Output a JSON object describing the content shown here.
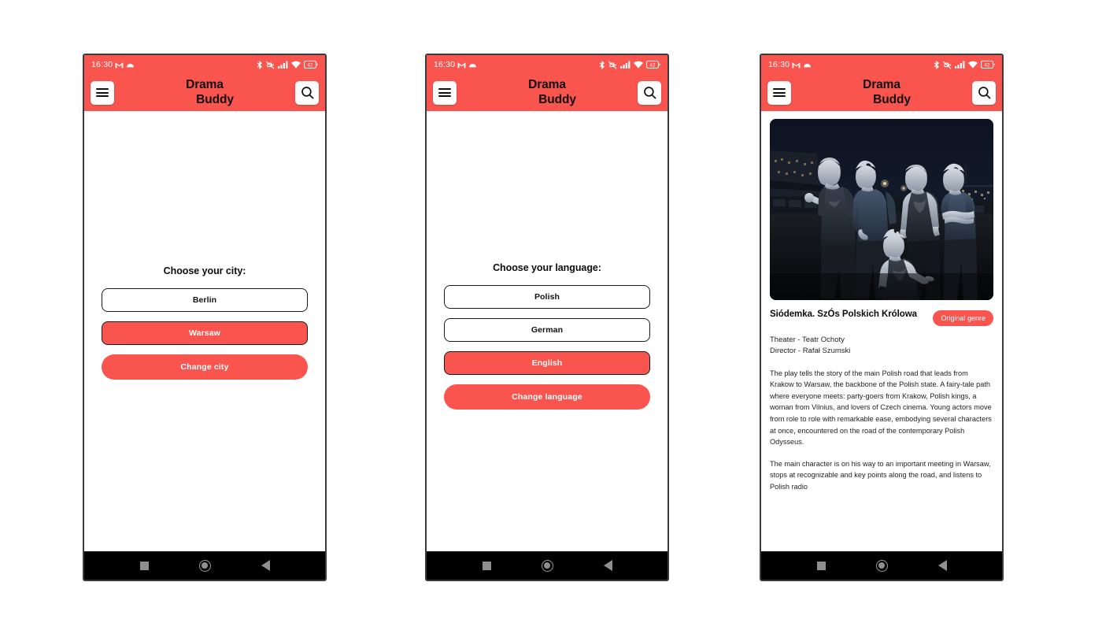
{
  "app": {
    "title_line1": "Drama",
    "title_line2": "Buddy",
    "accent_color": "#FA544F",
    "menu_icon": "hamburger-icon",
    "search_icon": "search-icon"
  },
  "status_bar": {
    "time": "16:30",
    "left_icons": [
      "gmail-icon",
      "arc-icon"
    ],
    "right_icons": [
      "bluetooth-icon",
      "vibrate-off-icon",
      "cellular-signal-icon",
      "wifi-icon",
      "battery-icon"
    ],
    "battery_level": "42"
  },
  "nav_bar": {
    "recents_label": "recents-square",
    "home_label": "home-circle",
    "back_label": "back-triangle"
  },
  "screens": [
    {
      "id": "city-chooser",
      "prompt": "Choose your city:",
      "options": [
        {
          "label": "Berlin",
          "selected": false
        },
        {
          "label": "Warsaw",
          "selected": true
        }
      ],
      "action_label": "Change city"
    },
    {
      "id": "language-chooser",
      "prompt": "Choose your language:",
      "options": [
        {
          "label": "Polish",
          "selected": false
        },
        {
          "label": "German",
          "selected": false
        },
        {
          "label": "English",
          "selected": true
        }
      ],
      "action_label": "Change language"
    },
    {
      "id": "play-detail",
      "hero_image_alt": "Five actors with pale body paint posing at night by a riverside",
      "show_title": "Siódemka. SzÓs Polskich Królowa",
      "genre_badge": "Original genre",
      "meta_theater": "Theater - Teatr Ochoty",
      "meta_director": "Director - Rafał Szumski",
      "paragraph_1": "The play tells the story of the main Polish road that leads from Krakow to Warsaw, the backbone of the Polish state. A fairy-tale path where everyone meets: party-goers from Krakow, Polish kings, a woman from Vilnius, and lovers of Czech cinema. Young actors move from role to role with remarkable ease, embodying several characters at once, encountered on the road of the contemporary Polish Odysseus.",
      "paragraph_2": "The main character is on his way to an important meeting in Warsaw, stops at recognizable and key points along the road, and listens to Polish radio"
    }
  ]
}
